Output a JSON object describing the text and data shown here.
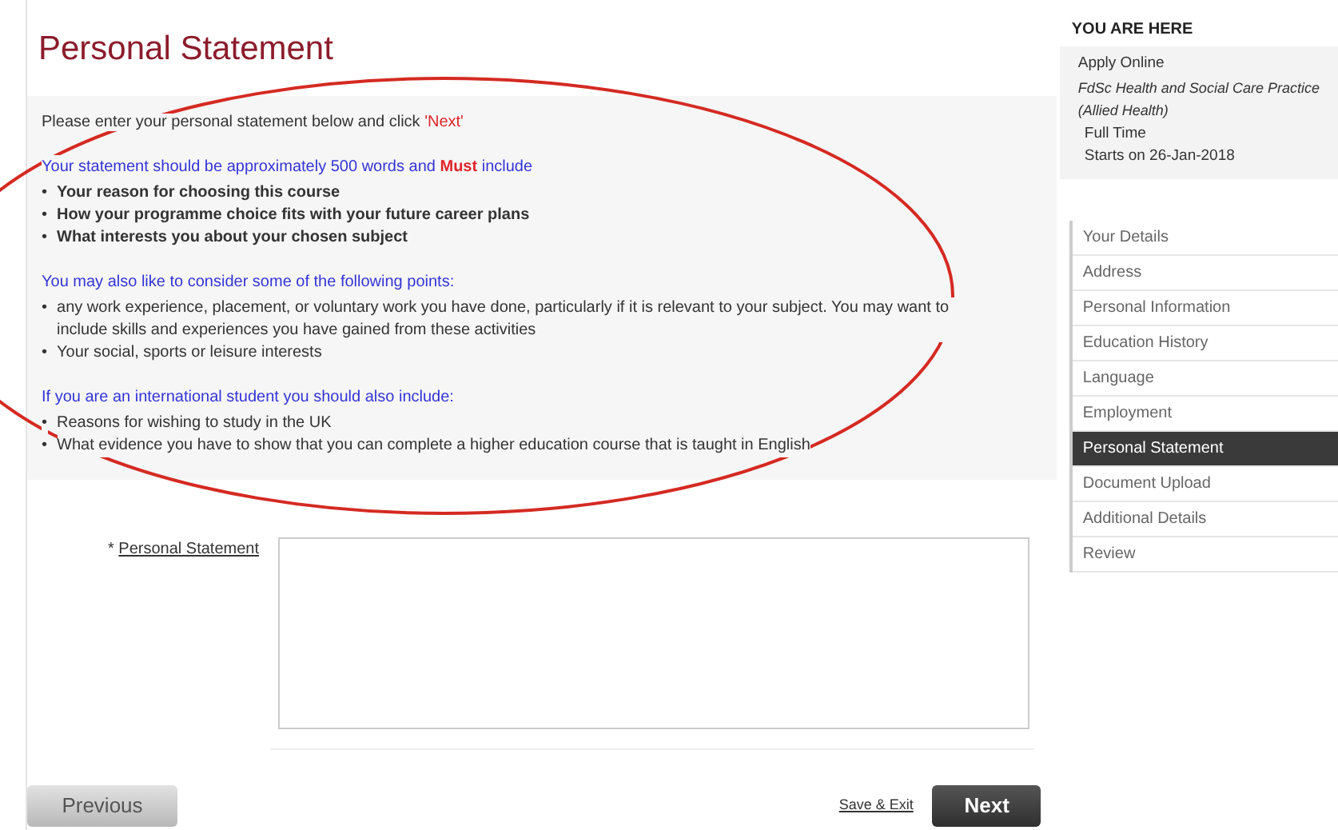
{
  "page_title": "Personal Statement",
  "instructions": [
    {
      "kind": "intro",
      "parts": [
        {
          "text": "Please enter your personal statement below and click ",
          "emphasis": false
        },
        {
          "text": "'Next'",
          "emphasis": true
        }
      ]
    },
    {
      "kind": "heading",
      "parts": [
        {
          "text": "Your statement should be approximately 500 words and ",
          "emphasis": false
        },
        {
          "text": "**Must**",
          "emphasis": true
        },
        {
          "text": " include",
          "emphasis": false
        }
      ]
    },
    {
      "kind": "list",
      "bold": true,
      "bullet": "•",
      "items": [
        "Your reason for choosing this course",
        "How your programme choice fits with your future career plans",
        "What interests you about your chosen subject"
      ]
    },
    {
      "kind": "heading",
      "parts": [
        {
          "text": "You may also like to consider some of the following points:",
          "emphasis": false
        }
      ]
    },
    {
      "kind": "list",
      "bold": false,
      "bullet": "•",
      "items": [
        "any work experience, placement, or voluntary work you have done, particularly if it is relevant to your subject. You may want to include skills and experiences you have gained from these activities",
        "Your social, sports or leisure interests"
      ]
    },
    {
      "kind": "heading",
      "parts": [
        {
          "text": "If you are an international student you should also include:",
          "emphasis": false
        }
      ]
    },
    {
      "kind": "list",
      "bold": false,
      "bullet": "•",
      "items": [
        "Reasons for wishing to study in the UK",
        "What evidence you have to show that you can complete a higher education course that is taught in English"
      ]
    }
  ],
  "field": {
    "required_mark": "*",
    "label": "Personal Statement"
  },
  "buttons": {
    "previous": "Previous",
    "save_exit": "Save & Exit",
    "next": "Next"
  },
  "sidebar": {
    "heading": "YOU ARE HERE",
    "summary": [
      {
        "text": "Apply Online",
        "italic": false,
        "indent": false
      },
      {
        "text": "FdSc Health and Social Care Practice (Allied Health)",
        "italic": true,
        "indent": false
      },
      {
        "text": "Full Time",
        "italic": false,
        "indent": true
      },
      {
        "text": "Starts on 26-Jan-2018",
        "italic": false,
        "indent": true
      }
    ],
    "steps": [
      {
        "label": "Your Details",
        "selected": false
      },
      {
        "label": "Address",
        "selected": false
      },
      {
        "label": "Personal Information",
        "selected": false
      },
      {
        "label": "Education History",
        "selected": false
      },
      {
        "label": "Language",
        "selected": false
      },
      {
        "label": "Employment",
        "selected": false
      },
      {
        "label": "Personal Statement",
        "selected": true
      },
      {
        "label": "Document Upload",
        "selected": false
      },
      {
        "label": "Additional Details",
        "selected": false
      },
      {
        "label": "Review",
        "selected": false
      }
    ]
  },
  "annotations": [
    {
      "kind": "ellipse",
      "color": "#d42a22"
    }
  ]
}
